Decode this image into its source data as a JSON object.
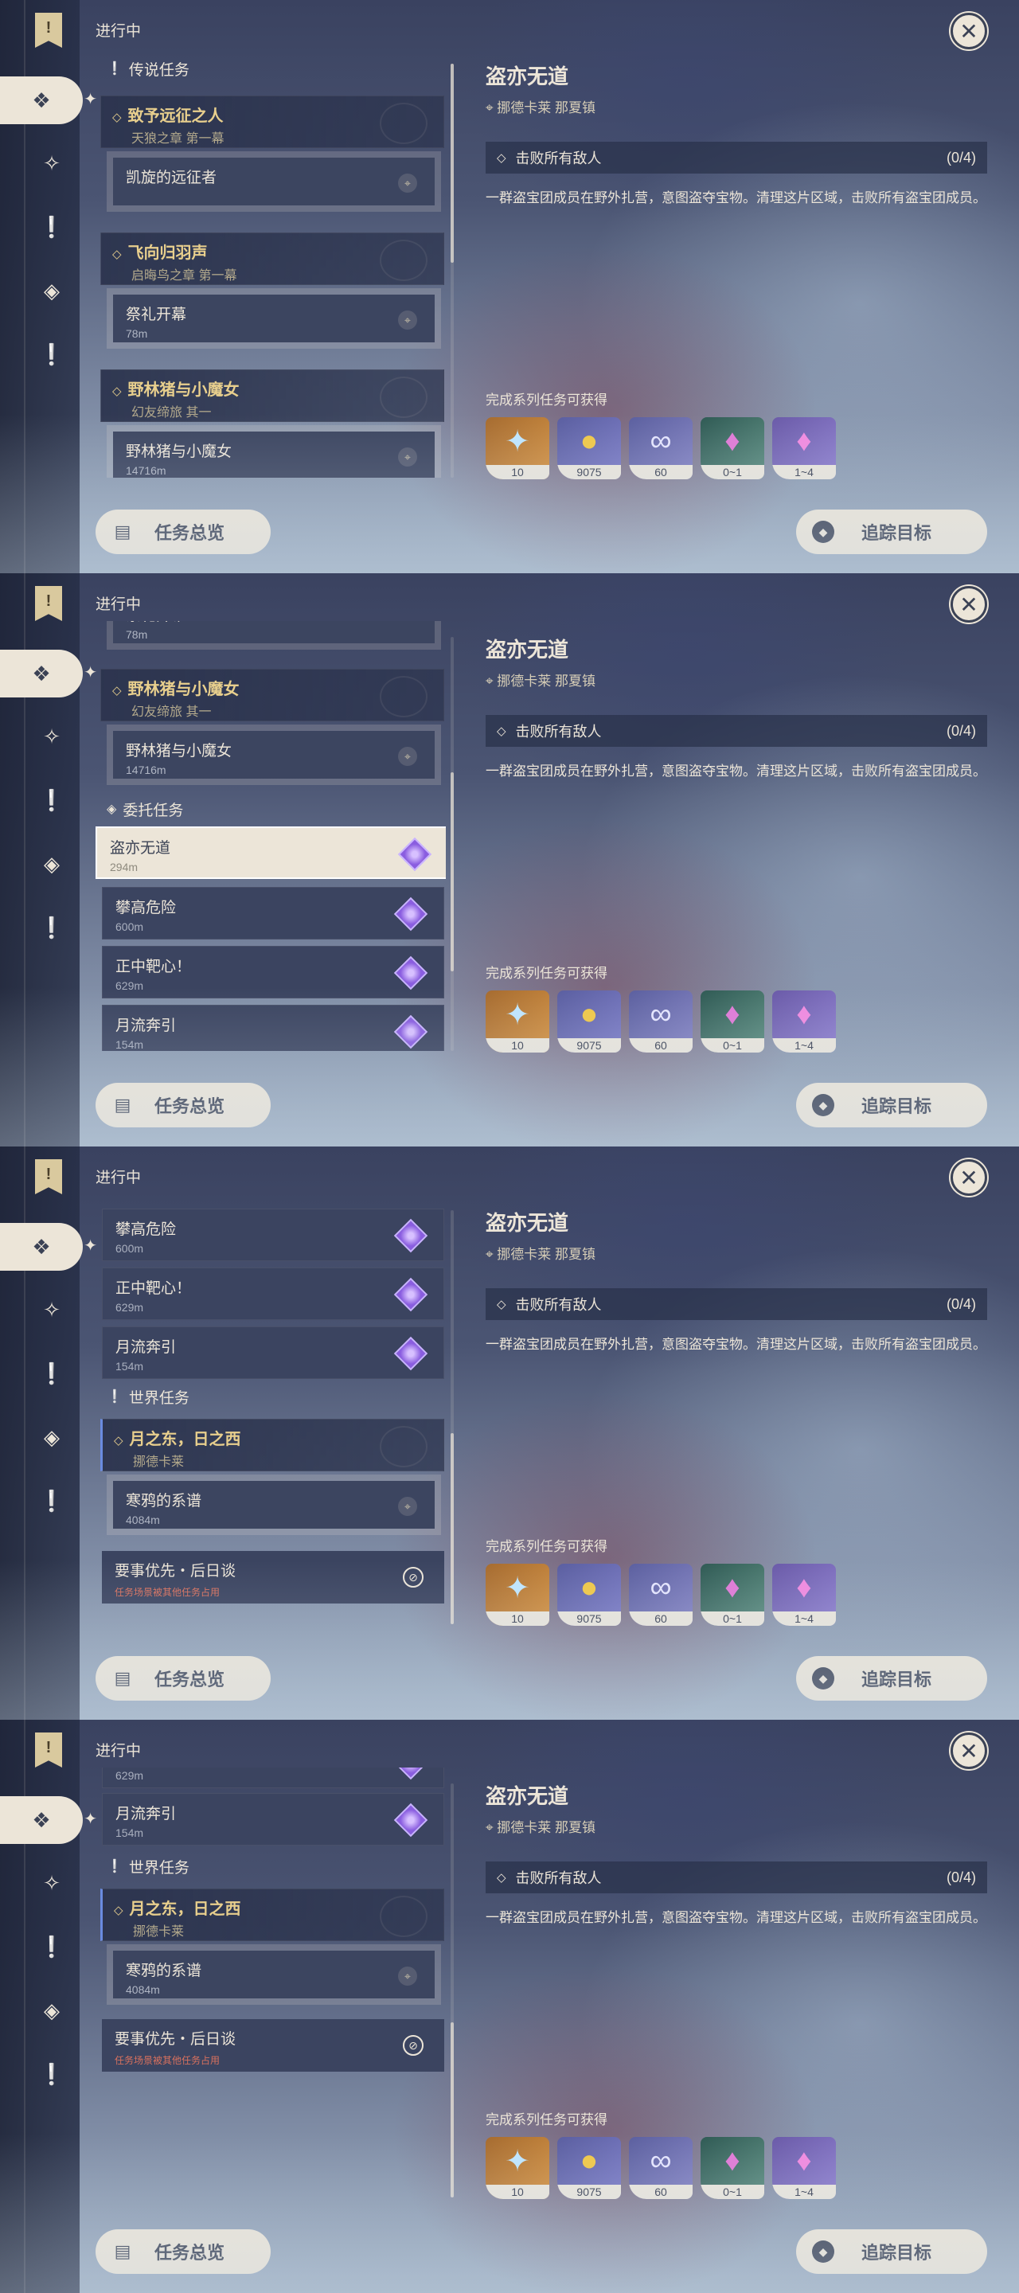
{
  "header": {
    "list_title": "进行中",
    "close_icon": "close-icon"
  },
  "categories": {
    "legend": "传说任务",
    "commission": "委托任务",
    "world": "世界任务"
  },
  "legend_quests": [
    {
      "title": "致予远征之人",
      "subtitle": "天狼之章 第一幕",
      "step": "凯旋的远征者",
      "distance": ""
    },
    {
      "title": "飞向归羽声",
      "subtitle": "启晦鸟之章 第一幕",
      "step": "祭礼开幕",
      "distance": "78m"
    },
    {
      "title": "野林猪与小魔女",
      "subtitle": "幻友缔旅 其一",
      "step": "野林猪与小魔女",
      "distance": "14716m"
    }
  ],
  "commissions": [
    {
      "title": "盗亦无道",
      "distance": "294m"
    },
    {
      "title": "攀高危险",
      "distance": "600m"
    },
    {
      "title": "正中靶心！",
      "distance": "629m"
    },
    {
      "title": "月流奔引",
      "distance": "154m"
    }
  ],
  "world_quest": {
    "title": "月之东，日之西",
    "subtitle": "挪德卡莱",
    "step": "寒鸦的系谱",
    "distance": "4084m"
  },
  "blocked_quest": {
    "title": "要事优先・后日谈",
    "note": "任务场景被其他任务占用"
  },
  "detail": {
    "title": "盗亦无道",
    "location": "挪德卡莱 那夏镇",
    "objective": "击败所有敌人",
    "objective_count": "(0/4)",
    "description": "一群盗宝团成员在野外扎营，意图盗夺宝物。清理这片区域，击败所有盗宝团成员。",
    "rewards_label": "完成系列任务可获得",
    "rewards": [
      {
        "icon": "primogem-icon",
        "count": "10"
      },
      {
        "icon": "mora-icon",
        "count": "9075"
      },
      {
        "icon": "fate-icon",
        "count": "60"
      },
      {
        "icon": "crystal-green-icon",
        "count": "0~1"
      },
      {
        "icon": "crystal-purple-icon",
        "count": "1~4"
      }
    ]
  },
  "buttons": {
    "overview": "任务总览",
    "track": "追踪目标"
  },
  "colors": {
    "accent": "#ece5d8",
    "gold": "#e8cf8d",
    "dark": "#3b4255",
    "warning": "#d8715e"
  }
}
